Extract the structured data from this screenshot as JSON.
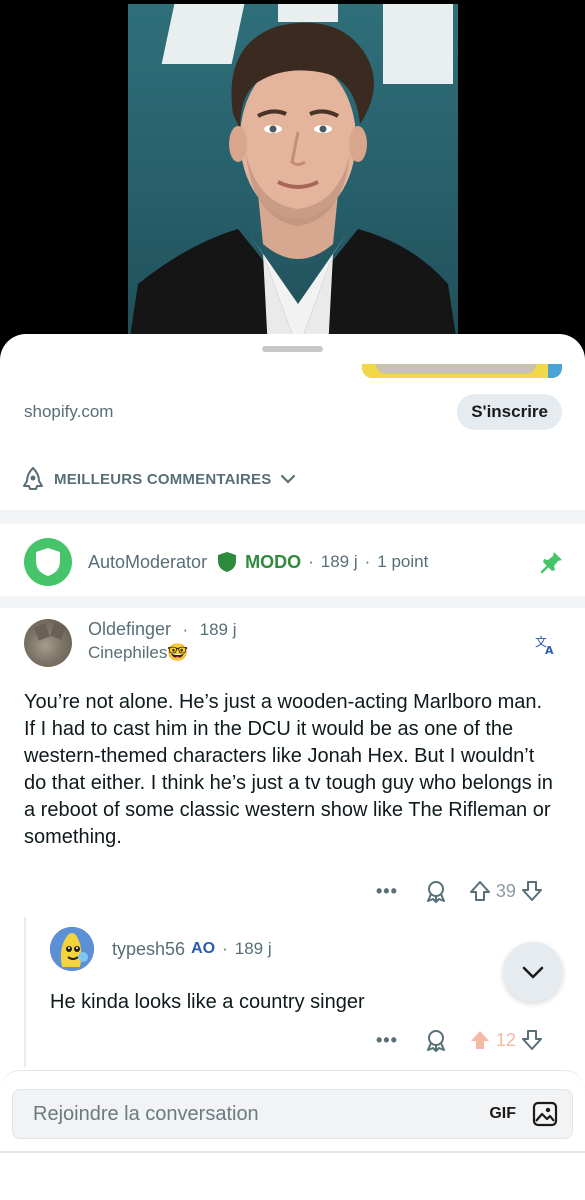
{
  "ad": {
    "domain": "shopify.com",
    "cta": "S'inscrire"
  },
  "sort": {
    "label": "MEILLEURS COMMENTAIRES"
  },
  "automod": {
    "name": "AutoModerator",
    "badge": "MODO",
    "age": "189 j",
    "points": "1 point"
  },
  "comment": {
    "user": "Oldefinger",
    "age": "189 j",
    "flair": "Cinephiles",
    "flair_emoji": "🤓",
    "body": "You’re not alone. He’s just a wooden-acting Marlboro man. If I had to cast him in the DCU it would be as one of the western-themed characters like Jonah Hex. But I wouldn’t do that either. I think he’s just a tv tough guy who belongs in a reboot of some classic western show like The Rifleman or something.",
    "more": "•••",
    "votes": "39"
  },
  "reply": {
    "user": "typesh56",
    "op_badge": "AO",
    "age": "189 j",
    "body": "He kinda looks like a country singer",
    "more": "•••",
    "votes": "12"
  },
  "composer": {
    "placeholder": "Rejoindre la conversation",
    "gif": "GIF"
  },
  "colors": {
    "mod_green": "#2e8b3d",
    "automod_avatar": "#46c46a",
    "op_blue": "#2a5db0",
    "upvoted": "#f2b9a3"
  }
}
